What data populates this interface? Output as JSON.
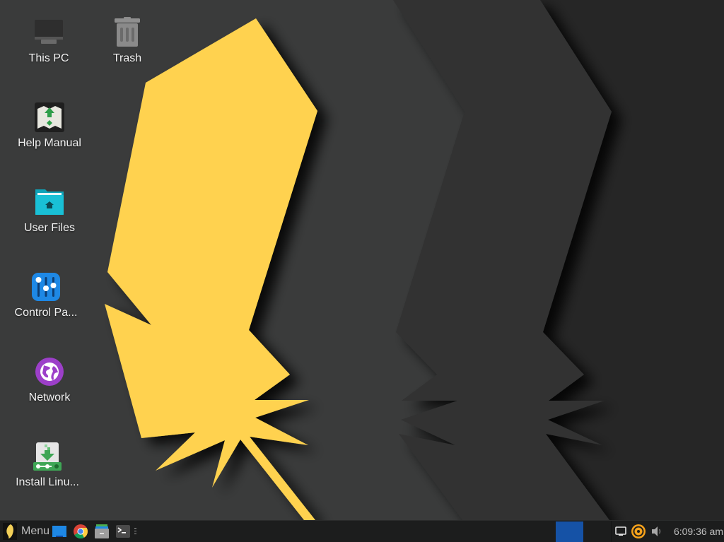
{
  "desktop": {
    "icons": [
      {
        "label": "This PC",
        "icon": "computer-monitor-icon"
      },
      {
        "label": "Trash",
        "icon": "trash-icon"
      },
      {
        "label": "Help Manual",
        "icon": "help-manual-map-icon"
      },
      {
        "label": "User Files",
        "icon": "home-folder-icon"
      },
      {
        "label": "Control Pa...",
        "icon": "control-panel-sliders-icon"
      },
      {
        "label": "Network",
        "icon": "network-globe-icon"
      },
      {
        "label": "Install Linu...",
        "icon": "install-download-icon"
      }
    ]
  },
  "taskbar": {
    "menu_label": "Menu",
    "launchers": [
      {
        "name": "show-desktop",
        "icon": "desktop-icon"
      },
      {
        "name": "chrome",
        "icon": "chrome-icon"
      },
      {
        "name": "file-manager",
        "icon": "file-cabinet-icon"
      },
      {
        "name": "terminal",
        "icon": "terminal-icon"
      }
    ],
    "workspaces": {
      "count": 2,
      "active": 1
    },
    "tray": [
      {
        "name": "display",
        "icon": "display-icon"
      },
      {
        "name": "sync",
        "icon": "sync-icon"
      },
      {
        "name": "volume",
        "icon": "volume-icon"
      }
    ],
    "clock": "6:09:36 am"
  },
  "colors": {
    "wallpaper_bg": "#3a3b3b",
    "accent_yellow": "#ffd24f",
    "taskbar_bg": "#1c1d1d",
    "workspace_active": "#1552a6"
  }
}
